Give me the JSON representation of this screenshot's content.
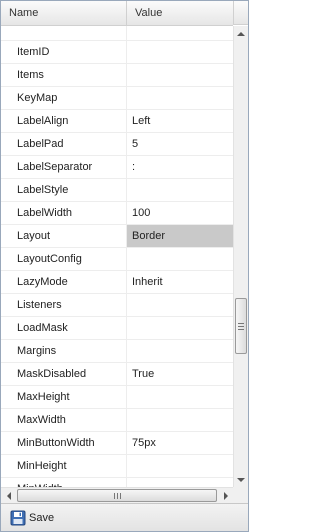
{
  "header": {
    "name_label": "Name",
    "value_label": "Value"
  },
  "rows": [
    {
      "name": "",
      "value": ""
    },
    {
      "name": "ItemID",
      "value": ""
    },
    {
      "name": "Items",
      "value": ""
    },
    {
      "name": "KeyMap",
      "value": ""
    },
    {
      "name": "LabelAlign",
      "value": "Left"
    },
    {
      "name": "LabelPad",
      "value": "5"
    },
    {
      "name": "LabelSeparator",
      "value": ":"
    },
    {
      "name": "LabelStyle",
      "value": ""
    },
    {
      "name": "LabelWidth",
      "value": "100"
    },
    {
      "name": "Layout",
      "value": "Border"
    },
    {
      "name": "LayoutConfig",
      "value": ""
    },
    {
      "name": "LazyMode",
      "value": "Inherit"
    },
    {
      "name": "Listeners",
      "value": ""
    },
    {
      "name": "LoadMask",
      "value": ""
    },
    {
      "name": "Margins",
      "value": ""
    },
    {
      "name": "MaskDisabled",
      "value": "True"
    },
    {
      "name": "MaxHeight",
      "value": ""
    },
    {
      "name": "MaxWidth",
      "value": ""
    },
    {
      "name": "MinButtonWidth",
      "value": "75px"
    },
    {
      "name": "MinHeight",
      "value": ""
    },
    {
      "name": "MinWidth",
      "value": ""
    }
  ],
  "selected_row_name": "Layout",
  "toolbar": {
    "save_label": "Save",
    "save_icon": "floppy-disk-icon"
  },
  "colors": {
    "selected_value_bg": "#c9c9c9",
    "border": "#99a8bb"
  }
}
